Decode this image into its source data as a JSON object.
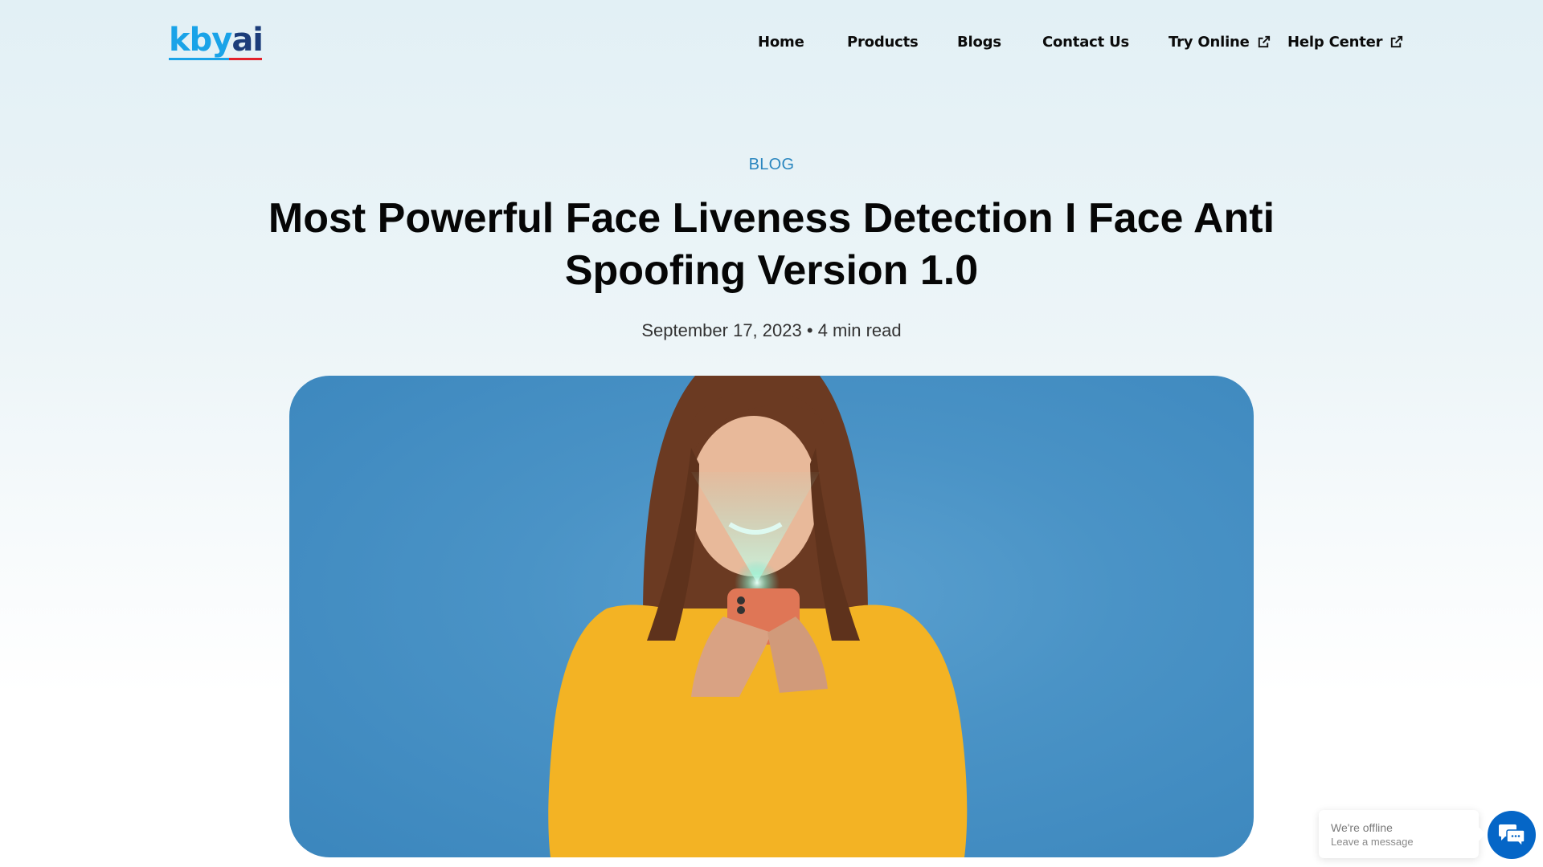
{
  "header": {
    "logo": {
      "part1": "kby",
      "part2": "ai",
      "brand_colors": {
        "primary": "#1aa3e8",
        "secondary": "#1c3d7a",
        "accent": "#e3222b"
      }
    },
    "nav": [
      {
        "label": "Home",
        "external": false
      },
      {
        "label": "Products",
        "external": false
      },
      {
        "label": "Blogs",
        "external": false
      },
      {
        "label": "Contact Us",
        "external": false
      },
      {
        "label": "Try Online",
        "external": true,
        "icon": "external-link-icon"
      },
      {
        "label": "Help Center",
        "external": true,
        "icon": "external-link-icon"
      }
    ]
  },
  "article": {
    "category": "BLOG",
    "title": "Most Powerful Face Liveness Detection  I Face Anti Spoofing Version 1.0",
    "date": "September 17, 2023",
    "separator": "•",
    "read_time": "4 min read",
    "hero_image": {
      "alt": "Woman in yellow sweater smiling at phone with face-scan light beam on blue background"
    }
  },
  "chat_widget": {
    "status": "We're offline",
    "prompt": "Leave a message",
    "icon": "chat-bubbles-icon",
    "color": "#0566c7"
  }
}
